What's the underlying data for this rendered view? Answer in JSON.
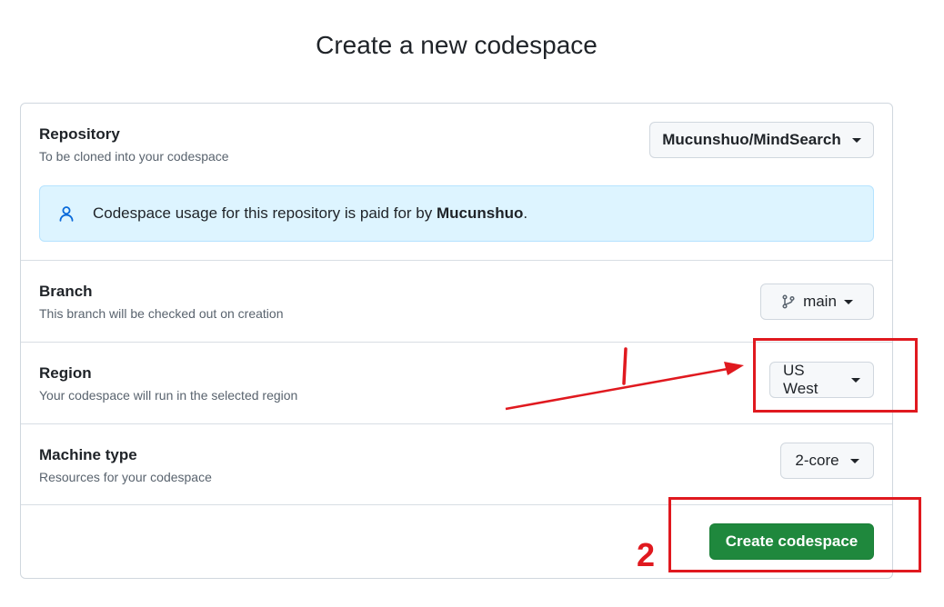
{
  "page": {
    "title": "Create a new codespace"
  },
  "repository": {
    "label": "Repository",
    "description": "To be cloned into your codespace",
    "selected": "Mucunshuo/MindSearch"
  },
  "notice": {
    "text_before": "Codespace usage for this repository is paid for by ",
    "owner": "Mucunshuo",
    "text_after": "."
  },
  "branch": {
    "label": "Branch",
    "description": "This branch will be checked out on creation",
    "selected": "main"
  },
  "region": {
    "label": "Region",
    "description": "Your codespace will run in the selected region",
    "selected": "US West"
  },
  "machine": {
    "label": "Machine type",
    "description": "Resources for your codespace",
    "selected": "2-core"
  },
  "actions": {
    "create_label": "Create codespace"
  },
  "annotations": {
    "color": "#e0191f",
    "step1": "1",
    "step2": "2"
  },
  "colors": {
    "primary_button": "#1f883d",
    "notice_bg": "#ddf4ff",
    "annotation": "#e0191f"
  }
}
